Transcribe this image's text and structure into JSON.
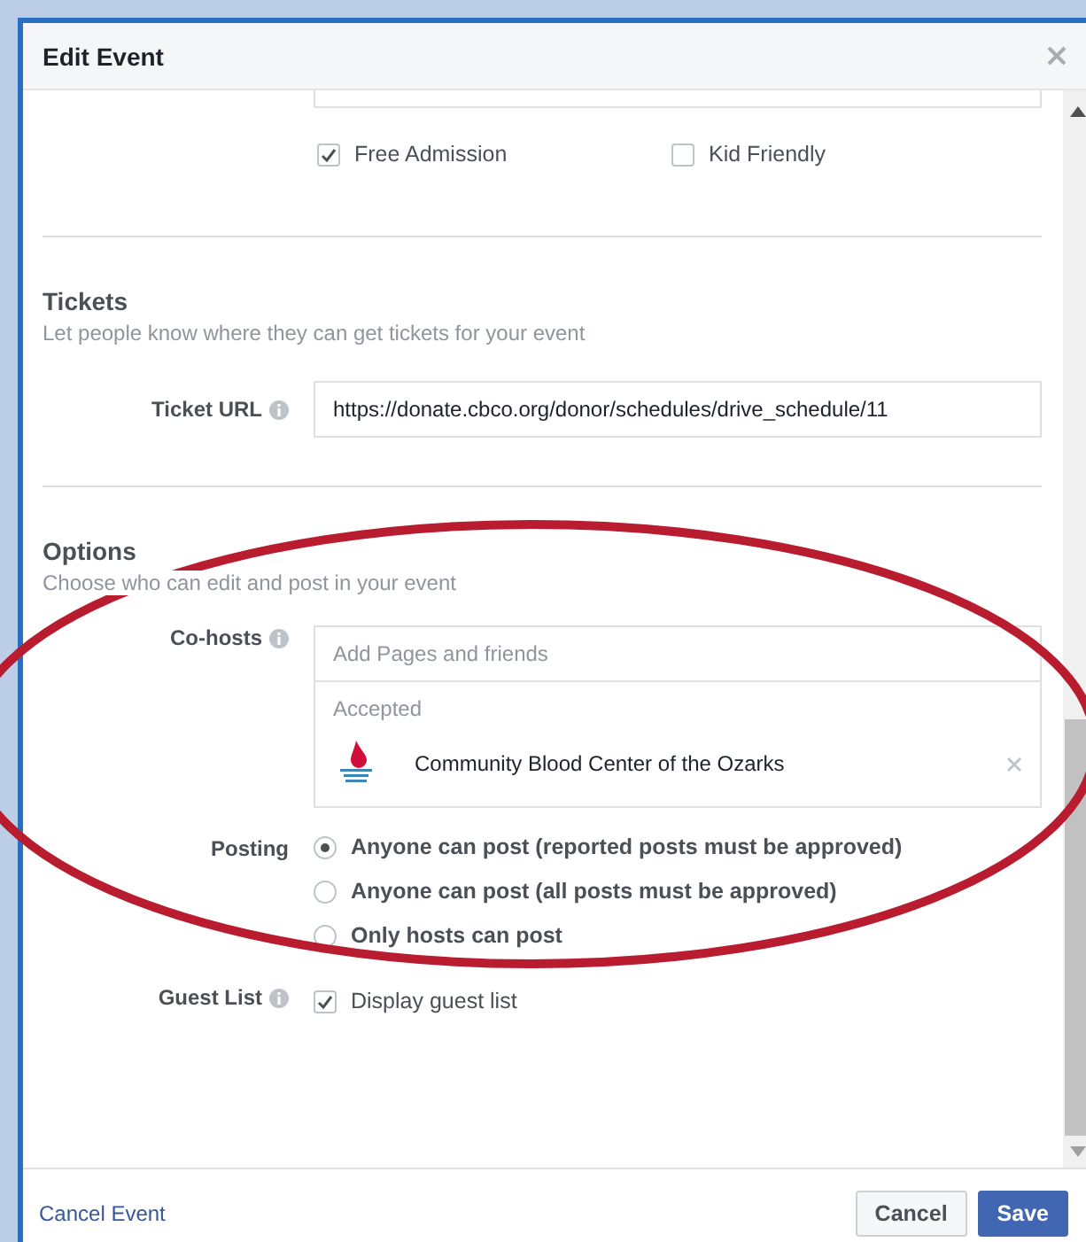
{
  "dialog": {
    "title": "Edit Event"
  },
  "categories": [
    {
      "label": "Free Admission",
      "checked": true
    },
    {
      "label": "Kid Friendly",
      "checked": false
    }
  ],
  "tickets": {
    "heading": "Tickets",
    "description": "Let people know where they can get tickets for your event",
    "url_label": "Ticket URL",
    "url_value": "https://donate.cbco.org/donor/schedules/drive_schedule/11"
  },
  "options": {
    "heading": "Options",
    "description": "Choose who can edit and post in your event",
    "cohosts": {
      "label": "Co-hosts",
      "placeholder": "Add Pages and friends",
      "accepted_label": "Accepted",
      "hosts": [
        {
          "name": "Community Blood Center of the Ozarks"
        }
      ]
    },
    "posting": {
      "label": "Posting",
      "choices": [
        {
          "label": "Anyone can post (reported posts must be approved)",
          "selected": true
        },
        {
          "label": "Anyone can post (all posts must be approved)",
          "selected": false
        },
        {
          "label": "Only hosts can post",
          "selected": false
        }
      ]
    },
    "guest_list": {
      "label": "Guest List",
      "option": {
        "label": "Display guest list",
        "checked": true
      }
    }
  },
  "footer": {
    "link": "Cancel Event",
    "buttons": [
      {
        "label": "Cancel",
        "kind": "secondary"
      },
      {
        "label": "Save",
        "kind": "primary"
      }
    ]
  }
}
